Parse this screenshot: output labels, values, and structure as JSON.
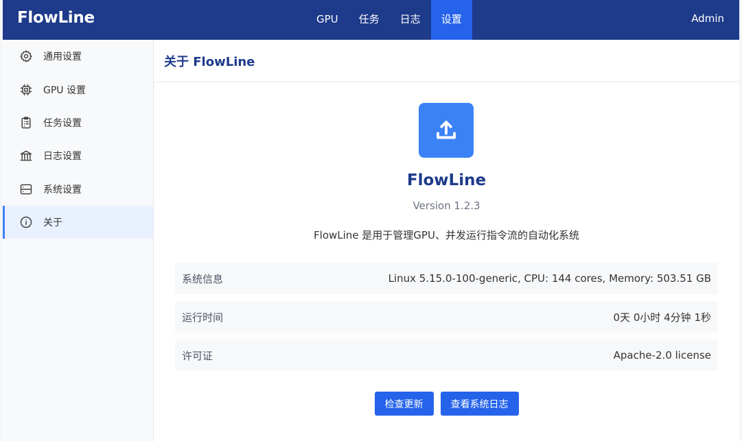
{
  "header": {
    "brand": "FlowLine",
    "nav": [
      {
        "label": "GPU",
        "active": false
      },
      {
        "label": "任务",
        "active": false
      },
      {
        "label": "日志",
        "active": false
      },
      {
        "label": "设置",
        "active": true
      }
    ],
    "user": "Admin"
  },
  "sidebar": {
    "items": [
      {
        "label": "通用设置",
        "icon": "gear-icon"
      },
      {
        "label": "GPU 设置",
        "icon": "chip-icon"
      },
      {
        "label": "任务设置",
        "icon": "clipboard-icon"
      },
      {
        "label": "日志设置",
        "icon": "bank-icon"
      },
      {
        "label": "系统设置",
        "icon": "server-icon"
      },
      {
        "label": "关于",
        "icon": "info-icon",
        "active": true
      }
    ]
  },
  "main": {
    "title": "关于 FlowLine",
    "logo_icon": "upload-icon",
    "app_name": "FlowLine",
    "version": "Version 1.2.3",
    "description": "FlowLine 是用于管理GPU、并发运行指令流的自动化系统",
    "info": [
      {
        "key": "系统信息",
        "value": "Linux 5.15.0-100-generic, CPU: 144 cores, Memory: 503.51 GB"
      },
      {
        "key": "运行时间",
        "value": "0天 0小时 4分钟 1秒"
      },
      {
        "key": "许可证",
        "value": "Apache-2.0 license"
      }
    ],
    "buttons": {
      "check_update": "检查更新",
      "view_logs": "查看系统日志"
    }
  },
  "colors": {
    "header_bg": "#1e3a8a",
    "accent": "#2563eb",
    "logo_bg": "#3b82f6",
    "sidebar_active_bg": "#eaf1fe"
  }
}
